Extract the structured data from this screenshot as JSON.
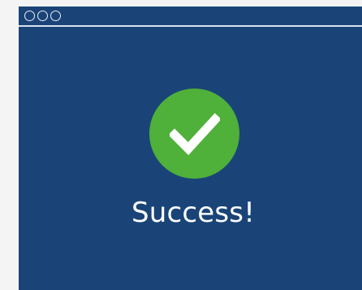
{
  "window": {
    "controls": [
      "window-control-1",
      "window-control-2",
      "window-control-3"
    ],
    "background_color": "#1a4478"
  },
  "status": {
    "icon": "check-icon",
    "icon_color": "#4fb03a",
    "message": "Success!"
  }
}
